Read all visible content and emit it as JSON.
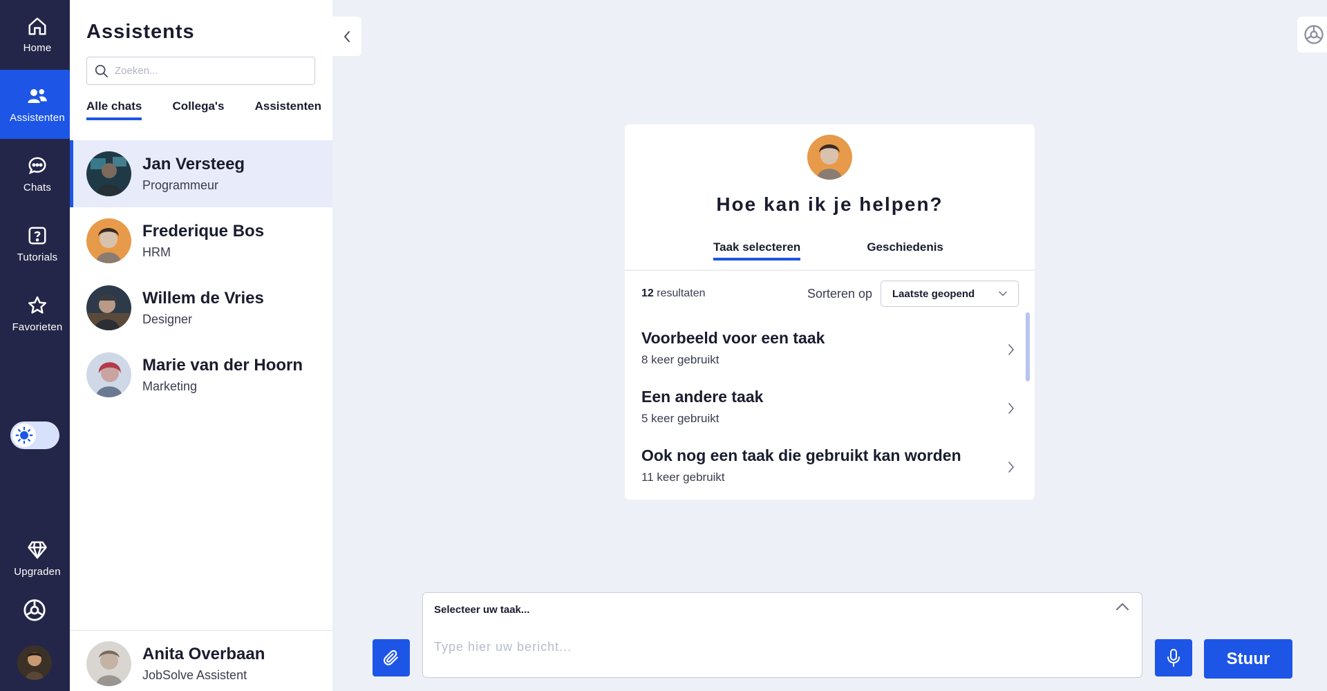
{
  "nav": {
    "items": [
      {
        "label": "Home",
        "icon": "home-icon"
      },
      {
        "label": "Assistenten",
        "icon": "users-icon"
      },
      {
        "label": "Chats",
        "icon": "chat-icon"
      },
      {
        "label": "Tutorials",
        "icon": "help-icon"
      },
      {
        "label": "Favorieten",
        "icon": "star-icon"
      },
      {
        "label": "Upgraden",
        "icon": "diamond-icon"
      }
    ],
    "active": "Assistenten",
    "theme_toggle_icon": "sun-icon"
  },
  "panel": {
    "title": "Assistents",
    "search_placeholder": "Zoeken...",
    "tabs": [
      "Alle chats",
      "Collega's",
      "Assistenten"
    ],
    "active_tab": "Alle chats",
    "contacts": [
      {
        "name": "Jan Versteeg",
        "role": "Programmeur"
      },
      {
        "name": "Frederique Bos",
        "role": "HRM"
      },
      {
        "name": "Willem de Vries",
        "role": "Designer"
      },
      {
        "name": "Marie van der Hoorn",
        "role": "Marketing"
      }
    ],
    "current_user": {
      "name": "Anita Overbaan",
      "role": "JobSolve Assistent"
    }
  },
  "card": {
    "heading": "Hoe kan ik je helpen?",
    "tabs": [
      "Taak selecteren",
      "Geschiedenis"
    ],
    "active_tab": "Taak selecteren",
    "results_count": "12",
    "results_suffix": " resultaten",
    "sort_label": "Sorteren op",
    "sort_value": "Laatste geopend",
    "tasks": [
      {
        "title": "Voorbeeld voor een taak",
        "usage": "8 keer gebruikt"
      },
      {
        "title": "Een andere taak",
        "usage": "5 keer gebruikt"
      },
      {
        "title": "Ook nog een taak die gebruikt kan worden",
        "usage": "11 keer gebruikt"
      }
    ]
  },
  "composer": {
    "task_select": "Selecteer uw taak...",
    "message_placeholder": "Type hier uw bericht...",
    "send_label": "Stuur"
  },
  "colors": {
    "rail_bg": "#232648",
    "accent": "#1d55e6",
    "page_bg": "#eef0f8",
    "active_row_bg": "#e8ebfa"
  }
}
